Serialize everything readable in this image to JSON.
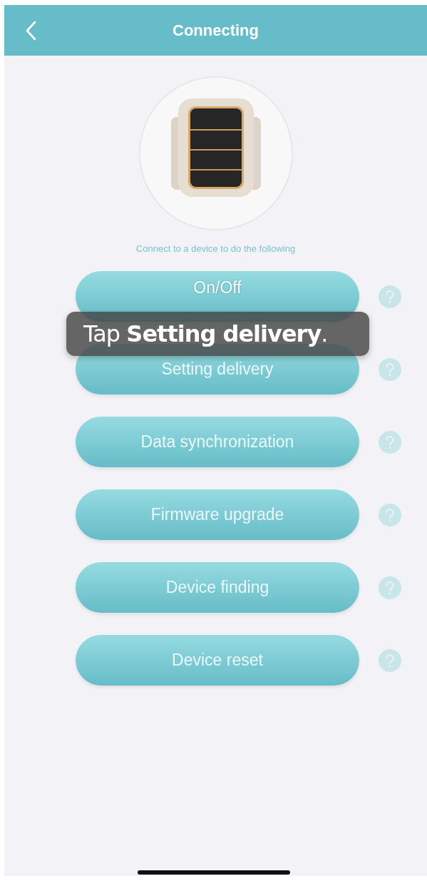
{
  "header": {
    "title": "Connecting"
  },
  "subtitle": "Connect to a device to do the following",
  "actions": [
    {
      "label": "On/Off"
    },
    {
      "label": "Setting delivery"
    },
    {
      "label": "Data synchronization"
    },
    {
      "label": "Firmware upgrade"
    },
    {
      "label": "Device finding"
    },
    {
      "label": "Device reset"
    }
  ],
  "caption": "Tap **Setting delivery**."
}
